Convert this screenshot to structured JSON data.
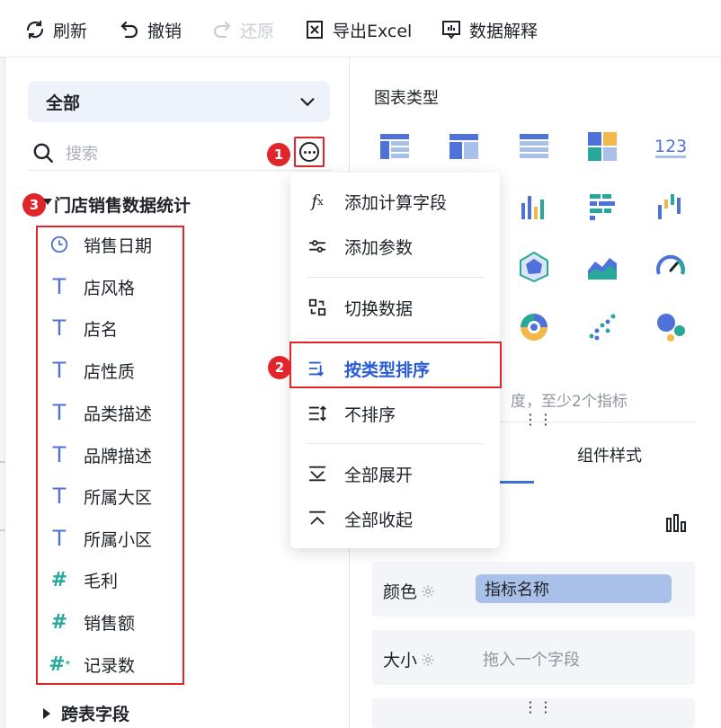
{
  "toolbar": {
    "refresh": "刷新",
    "undo": "撤销",
    "redo": "还原",
    "export": "导出Excel",
    "explain": "数据解释"
  },
  "left": {
    "dataset_selected": "全部",
    "search_placeholder": "搜索",
    "tree_title": "门店销售数据统计",
    "fields": [
      {
        "label": "销售日期",
        "type": "date"
      },
      {
        "label": "店风格",
        "type": "dimension"
      },
      {
        "label": "店名",
        "type": "dimension"
      },
      {
        "label": "店性质",
        "type": "dimension"
      },
      {
        "label": "品类描述",
        "type": "dimension"
      },
      {
        "label": "品牌描述",
        "type": "dimension"
      },
      {
        "label": "所属大区",
        "type": "dimension"
      },
      {
        "label": "所属小区",
        "type": "dimension"
      },
      {
        "label": "毛利",
        "type": "measure"
      },
      {
        "label": "销售额",
        "type": "measure"
      },
      {
        "label": "记录数",
        "type": "measure"
      }
    ],
    "cross_table": "跨表字段"
  },
  "badges": {
    "b1": "1",
    "b2": "2",
    "b3": "3"
  },
  "menu": {
    "items": [
      {
        "label": "添加计算字段",
        "icon": "fx-icon"
      },
      {
        "label": "添加参数",
        "icon": "sliders-icon"
      },
      {
        "label": "切换数据",
        "icon": "switch-icon"
      },
      {
        "label": "按类型排序",
        "icon": "sort-type-icon",
        "active": true
      },
      {
        "label": "不排序",
        "icon": "no-sort-icon"
      },
      {
        "label": "全部展开",
        "icon": "expand-all-icon"
      },
      {
        "label": "全部收起",
        "icon": "collapse-all-icon"
      }
    ]
  },
  "right": {
    "chart_type_title": "图表类型",
    "hint": "度，至少2个指标",
    "tab_style": "组件样式",
    "color_label": "颜色",
    "color_value": "指标名称",
    "size_label": "大小",
    "size_placeholder": "拖入一个字段",
    "dots": "⋮⋮"
  },
  "colors": {
    "accent": "#2a5bd7",
    "highlight_red": "#e0252b",
    "dimension_blue": "#4e72d9",
    "measure_teal": "#27a89a"
  }
}
